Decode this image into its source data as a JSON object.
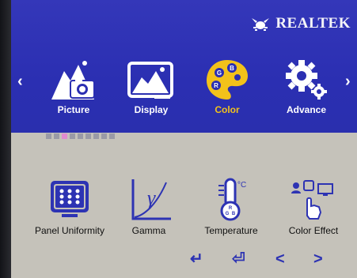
{
  "brand": {
    "name": "REALTEK",
    "logo_icon": "realtek-crab-icon"
  },
  "nav": {
    "left_arrow": "‹",
    "right_arrow": "›"
  },
  "main_menu": [
    {
      "label": "Picture",
      "icon": "picture-camera-icon",
      "selected": false
    },
    {
      "label": "Display",
      "icon": "display-image-icon",
      "selected": false
    },
    {
      "label": "Color",
      "icon": "color-palette-icon",
      "selected": true,
      "selected_color": "#f2c21a"
    },
    {
      "label": "Advance",
      "icon": "gear-icon",
      "selected": false
    }
  ],
  "page_indicator": {
    "total": 9,
    "active_index": 2
  },
  "submenu": [
    {
      "label": "Panel Uniformity",
      "icon": "panel-uniformity-icon"
    },
    {
      "label": "Gamma",
      "icon": "gamma-curve-icon"
    },
    {
      "label": "Temperature",
      "icon": "thermometer-icon"
    },
    {
      "label": "Color Effect",
      "icon": "color-effect-icon"
    }
  ],
  "footer_buttons": [
    {
      "label": "↵",
      "icon": "enter-icon"
    },
    {
      "label": "⏎",
      "icon": "exit-icon"
    },
    {
      "label": "<",
      "icon": "left-icon"
    },
    {
      "label": ">",
      "icon": "right-icon"
    }
  ],
  "colors": {
    "header_blue": "#2b2fb2",
    "body_gray": "#c5c2ba",
    "footer_icon": "#2d33b3"
  }
}
